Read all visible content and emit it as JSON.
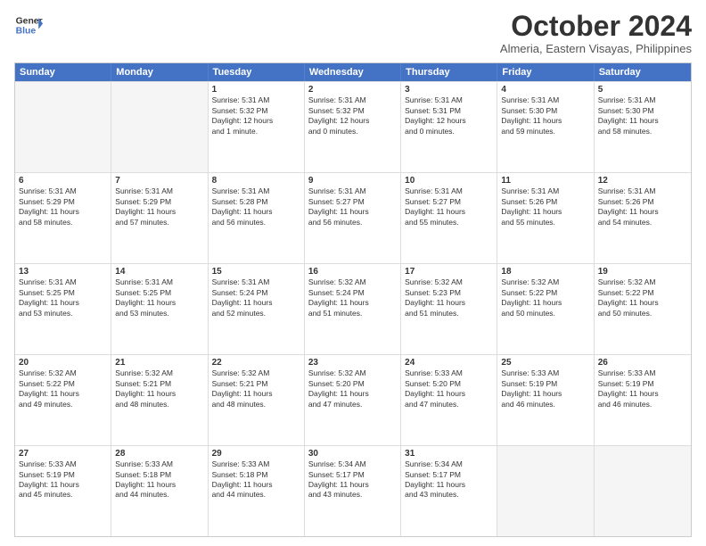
{
  "logo": {
    "line1": "General",
    "line2": "Blue"
  },
  "title": "October 2024",
  "subtitle": "Almeria, Eastern Visayas, Philippines",
  "headers": [
    "Sunday",
    "Monday",
    "Tuesday",
    "Wednesday",
    "Thursday",
    "Friday",
    "Saturday"
  ],
  "rows": [
    [
      {
        "day": "",
        "lines": [],
        "empty": true
      },
      {
        "day": "",
        "lines": [],
        "empty": true
      },
      {
        "day": "1",
        "lines": [
          "Sunrise: 5:31 AM",
          "Sunset: 5:32 PM",
          "Daylight: 12 hours",
          "and 1 minute."
        ]
      },
      {
        "day": "2",
        "lines": [
          "Sunrise: 5:31 AM",
          "Sunset: 5:32 PM",
          "Daylight: 12 hours",
          "and 0 minutes."
        ]
      },
      {
        "day": "3",
        "lines": [
          "Sunrise: 5:31 AM",
          "Sunset: 5:31 PM",
          "Daylight: 12 hours",
          "and 0 minutes."
        ]
      },
      {
        "day": "4",
        "lines": [
          "Sunrise: 5:31 AM",
          "Sunset: 5:30 PM",
          "Daylight: 11 hours",
          "and 59 minutes."
        ]
      },
      {
        "day": "5",
        "lines": [
          "Sunrise: 5:31 AM",
          "Sunset: 5:30 PM",
          "Daylight: 11 hours",
          "and 58 minutes."
        ]
      }
    ],
    [
      {
        "day": "6",
        "lines": [
          "Sunrise: 5:31 AM",
          "Sunset: 5:29 PM",
          "Daylight: 11 hours",
          "and 58 minutes."
        ]
      },
      {
        "day": "7",
        "lines": [
          "Sunrise: 5:31 AM",
          "Sunset: 5:29 PM",
          "Daylight: 11 hours",
          "and 57 minutes."
        ]
      },
      {
        "day": "8",
        "lines": [
          "Sunrise: 5:31 AM",
          "Sunset: 5:28 PM",
          "Daylight: 11 hours",
          "and 56 minutes."
        ]
      },
      {
        "day": "9",
        "lines": [
          "Sunrise: 5:31 AM",
          "Sunset: 5:27 PM",
          "Daylight: 11 hours",
          "and 56 minutes."
        ]
      },
      {
        "day": "10",
        "lines": [
          "Sunrise: 5:31 AM",
          "Sunset: 5:27 PM",
          "Daylight: 11 hours",
          "and 55 minutes."
        ]
      },
      {
        "day": "11",
        "lines": [
          "Sunrise: 5:31 AM",
          "Sunset: 5:26 PM",
          "Daylight: 11 hours",
          "and 55 minutes."
        ]
      },
      {
        "day": "12",
        "lines": [
          "Sunrise: 5:31 AM",
          "Sunset: 5:26 PM",
          "Daylight: 11 hours",
          "and 54 minutes."
        ]
      }
    ],
    [
      {
        "day": "13",
        "lines": [
          "Sunrise: 5:31 AM",
          "Sunset: 5:25 PM",
          "Daylight: 11 hours",
          "and 53 minutes."
        ]
      },
      {
        "day": "14",
        "lines": [
          "Sunrise: 5:31 AM",
          "Sunset: 5:25 PM",
          "Daylight: 11 hours",
          "and 53 minutes."
        ]
      },
      {
        "day": "15",
        "lines": [
          "Sunrise: 5:31 AM",
          "Sunset: 5:24 PM",
          "Daylight: 11 hours",
          "and 52 minutes."
        ]
      },
      {
        "day": "16",
        "lines": [
          "Sunrise: 5:32 AM",
          "Sunset: 5:24 PM",
          "Daylight: 11 hours",
          "and 51 minutes."
        ]
      },
      {
        "day": "17",
        "lines": [
          "Sunrise: 5:32 AM",
          "Sunset: 5:23 PM",
          "Daylight: 11 hours",
          "and 51 minutes."
        ]
      },
      {
        "day": "18",
        "lines": [
          "Sunrise: 5:32 AM",
          "Sunset: 5:22 PM",
          "Daylight: 11 hours",
          "and 50 minutes."
        ]
      },
      {
        "day": "19",
        "lines": [
          "Sunrise: 5:32 AM",
          "Sunset: 5:22 PM",
          "Daylight: 11 hours",
          "and 50 minutes."
        ]
      }
    ],
    [
      {
        "day": "20",
        "lines": [
          "Sunrise: 5:32 AM",
          "Sunset: 5:22 PM",
          "Daylight: 11 hours",
          "and 49 minutes."
        ]
      },
      {
        "day": "21",
        "lines": [
          "Sunrise: 5:32 AM",
          "Sunset: 5:21 PM",
          "Daylight: 11 hours",
          "and 48 minutes."
        ]
      },
      {
        "day": "22",
        "lines": [
          "Sunrise: 5:32 AM",
          "Sunset: 5:21 PM",
          "Daylight: 11 hours",
          "and 48 minutes."
        ]
      },
      {
        "day": "23",
        "lines": [
          "Sunrise: 5:32 AM",
          "Sunset: 5:20 PM",
          "Daylight: 11 hours",
          "and 47 minutes."
        ]
      },
      {
        "day": "24",
        "lines": [
          "Sunrise: 5:33 AM",
          "Sunset: 5:20 PM",
          "Daylight: 11 hours",
          "and 47 minutes."
        ]
      },
      {
        "day": "25",
        "lines": [
          "Sunrise: 5:33 AM",
          "Sunset: 5:19 PM",
          "Daylight: 11 hours",
          "and 46 minutes."
        ]
      },
      {
        "day": "26",
        "lines": [
          "Sunrise: 5:33 AM",
          "Sunset: 5:19 PM",
          "Daylight: 11 hours",
          "and 46 minutes."
        ]
      }
    ],
    [
      {
        "day": "27",
        "lines": [
          "Sunrise: 5:33 AM",
          "Sunset: 5:19 PM",
          "Daylight: 11 hours",
          "and 45 minutes."
        ]
      },
      {
        "day": "28",
        "lines": [
          "Sunrise: 5:33 AM",
          "Sunset: 5:18 PM",
          "Daylight: 11 hours",
          "and 44 minutes."
        ]
      },
      {
        "day": "29",
        "lines": [
          "Sunrise: 5:33 AM",
          "Sunset: 5:18 PM",
          "Daylight: 11 hours",
          "and 44 minutes."
        ]
      },
      {
        "day": "30",
        "lines": [
          "Sunrise: 5:34 AM",
          "Sunset: 5:17 PM",
          "Daylight: 11 hours",
          "and 43 minutes."
        ]
      },
      {
        "day": "31",
        "lines": [
          "Sunrise: 5:34 AM",
          "Sunset: 5:17 PM",
          "Daylight: 11 hours",
          "and 43 minutes."
        ]
      },
      {
        "day": "",
        "lines": [],
        "empty": true
      },
      {
        "day": "",
        "lines": [],
        "empty": true
      }
    ]
  ]
}
